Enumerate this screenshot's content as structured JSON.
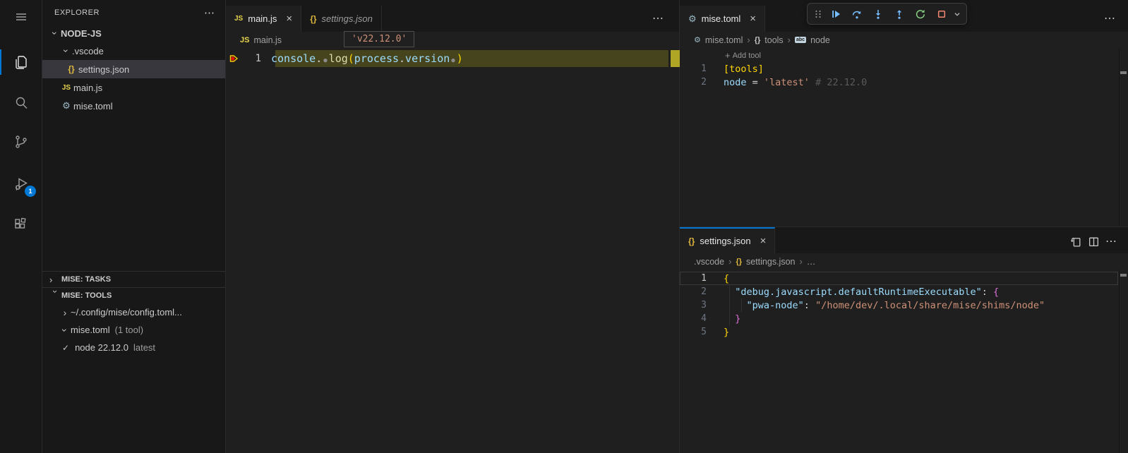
{
  "activity_bar": {
    "items": [
      {
        "name": "menu"
      },
      {
        "name": "explorer",
        "active": true
      },
      {
        "name": "search"
      },
      {
        "name": "source-control"
      },
      {
        "name": "run-and-debug",
        "badge": "1"
      },
      {
        "name": "extensions"
      }
    ],
    "badge": "1"
  },
  "explorer": {
    "title": "EXPLORER",
    "more_label": "⋯",
    "root": "NODE-JS",
    "items": [
      {
        "label": ".vscode",
        "kind": "folder",
        "expanded": true,
        "pad": 26
      },
      {
        "label": "settings.json",
        "kind": "file",
        "icon": "json",
        "selected": true,
        "pad": 31
      },
      {
        "label": "main.js",
        "kind": "file",
        "icon": "js",
        "pad": 24
      },
      {
        "label": "mise.toml",
        "kind": "file",
        "icon": "gear",
        "pad": 24
      }
    ],
    "sections": [
      {
        "label": "MISE: TASKS",
        "expanded": false
      },
      {
        "label": "MISE: TOOLS",
        "expanded": true
      }
    ],
    "tools": [
      {
        "label": "~/.config/mise/config.toml...",
        "chevron": "collapsed",
        "pad": 24
      },
      {
        "label": "mise.toml",
        "suffix": "(1 tool)",
        "chevron": "expanded",
        "pad": 24
      },
      {
        "label": "node 22.12.0",
        "suffix": "latest",
        "check": true,
        "pad": 28
      }
    ]
  },
  "icon_glyphs": {
    "js": "JS",
    "json": "{}",
    "gear": "⚙",
    "chev": "›",
    "close": "×",
    "check": "✓",
    "plus": "+",
    "more": "⋯",
    "braces": "{}",
    "dots": "…"
  },
  "main_editor": {
    "tabs": [
      {
        "label": "main.js",
        "icon": "js",
        "active": true,
        "close": true
      },
      {
        "label": "settings.json",
        "icon": "json",
        "preview": true
      }
    ],
    "more_label": "⋯",
    "breadcrumb": [
      {
        "icon": "js",
        "label": "main.js"
      }
    ],
    "tooltip": "'v22.12.0'",
    "lines": [
      {
        "num": "1",
        "highlight": true,
        "breakpoint": true,
        "bright": true,
        "tokens": [
          {
            "t": "console",
            "c": "blue"
          },
          {
            "t": ".",
            "c": "white"
          },
          {
            "t": "●",
            "c": "dot"
          },
          {
            "t": "log",
            "c": "fn"
          },
          {
            "t": "(",
            "c": "gold"
          },
          {
            "t": "process",
            "c": "blue"
          },
          {
            "t": ".",
            "c": "white"
          },
          {
            "t": "version",
            "c": "blue"
          },
          {
            "t": "●",
            "c": "dot"
          },
          {
            "t": ")",
            "c": "gold"
          }
        ]
      }
    ]
  },
  "debug_toolbar": {
    "buttons": [
      "drag-handle",
      "continue",
      "step-over",
      "step-into",
      "step-out",
      "restart",
      "stop",
      "chevron-down"
    ]
  },
  "top_right_editor": {
    "tabs": [
      {
        "label": "mise.toml",
        "icon": "gear",
        "active": true,
        "close": true
      }
    ],
    "more_label": "⋯",
    "breadcrumb": [
      {
        "icon": "gear",
        "label": "mise.toml"
      },
      {
        "icon": "braces",
        "label": "tools"
      },
      {
        "icon": "abc",
        "label": "node"
      }
    ],
    "codelens": "Add tool",
    "lines": [
      {
        "num": "1",
        "tokens": [
          {
            "t": "[",
            "c": "gold"
          },
          {
            "t": "tools",
            "c": "gold"
          },
          {
            "t": "]",
            "c": "gold"
          }
        ]
      },
      {
        "num": "2",
        "tokens": [
          {
            "t": "node",
            "c": "blue"
          },
          {
            "t": " = ",
            "c": "white"
          },
          {
            "t": "'latest'",
            "c": "orange"
          },
          {
            "t": " ",
            "c": "white"
          },
          {
            "t": "# 22.12.0",
            "c": "ghost"
          }
        ]
      }
    ]
  },
  "bottom_right_editor": {
    "tabs": [
      {
        "label": "settings.json",
        "icon": "json",
        "active": true,
        "close": true,
        "focused": true
      }
    ],
    "actions": [
      "open-changes",
      "split-editor",
      "more"
    ],
    "more_label": "⋯",
    "breadcrumb": [
      {
        "label": ".vscode"
      },
      {
        "icon": "braces_gold",
        "label": "settings.json"
      },
      {
        "label": "…"
      }
    ],
    "lines": [
      {
        "num": "1",
        "current": true,
        "bright": true,
        "tokens": [
          {
            "t": "{",
            "c": "gold"
          }
        ]
      },
      {
        "num": "2",
        "tokens": [
          {
            "t": "  ",
            "c": "white"
          },
          {
            "t": "\"debug.javascript.defaultRuntimeExecutable\"",
            "c": "blue"
          },
          {
            "t": ": ",
            "c": "white"
          },
          {
            "t": "{",
            "c": "pink"
          }
        ]
      },
      {
        "num": "3",
        "tokens": [
          {
            "t": "    ",
            "c": "white"
          },
          {
            "t": "\"pwa-node\"",
            "c": "blue"
          },
          {
            "t": ": ",
            "c": "white"
          },
          {
            "t": "\"/home/dev/.local/share/mise/shims/node\"",
            "c": "orange"
          }
        ]
      },
      {
        "num": "4",
        "tokens": [
          {
            "t": "  ",
            "c": "white"
          },
          {
            "t": "}",
            "c": "pink"
          }
        ]
      },
      {
        "num": "5",
        "tokens": [
          {
            "t": "}",
            "c": "gold"
          }
        ]
      }
    ]
  }
}
